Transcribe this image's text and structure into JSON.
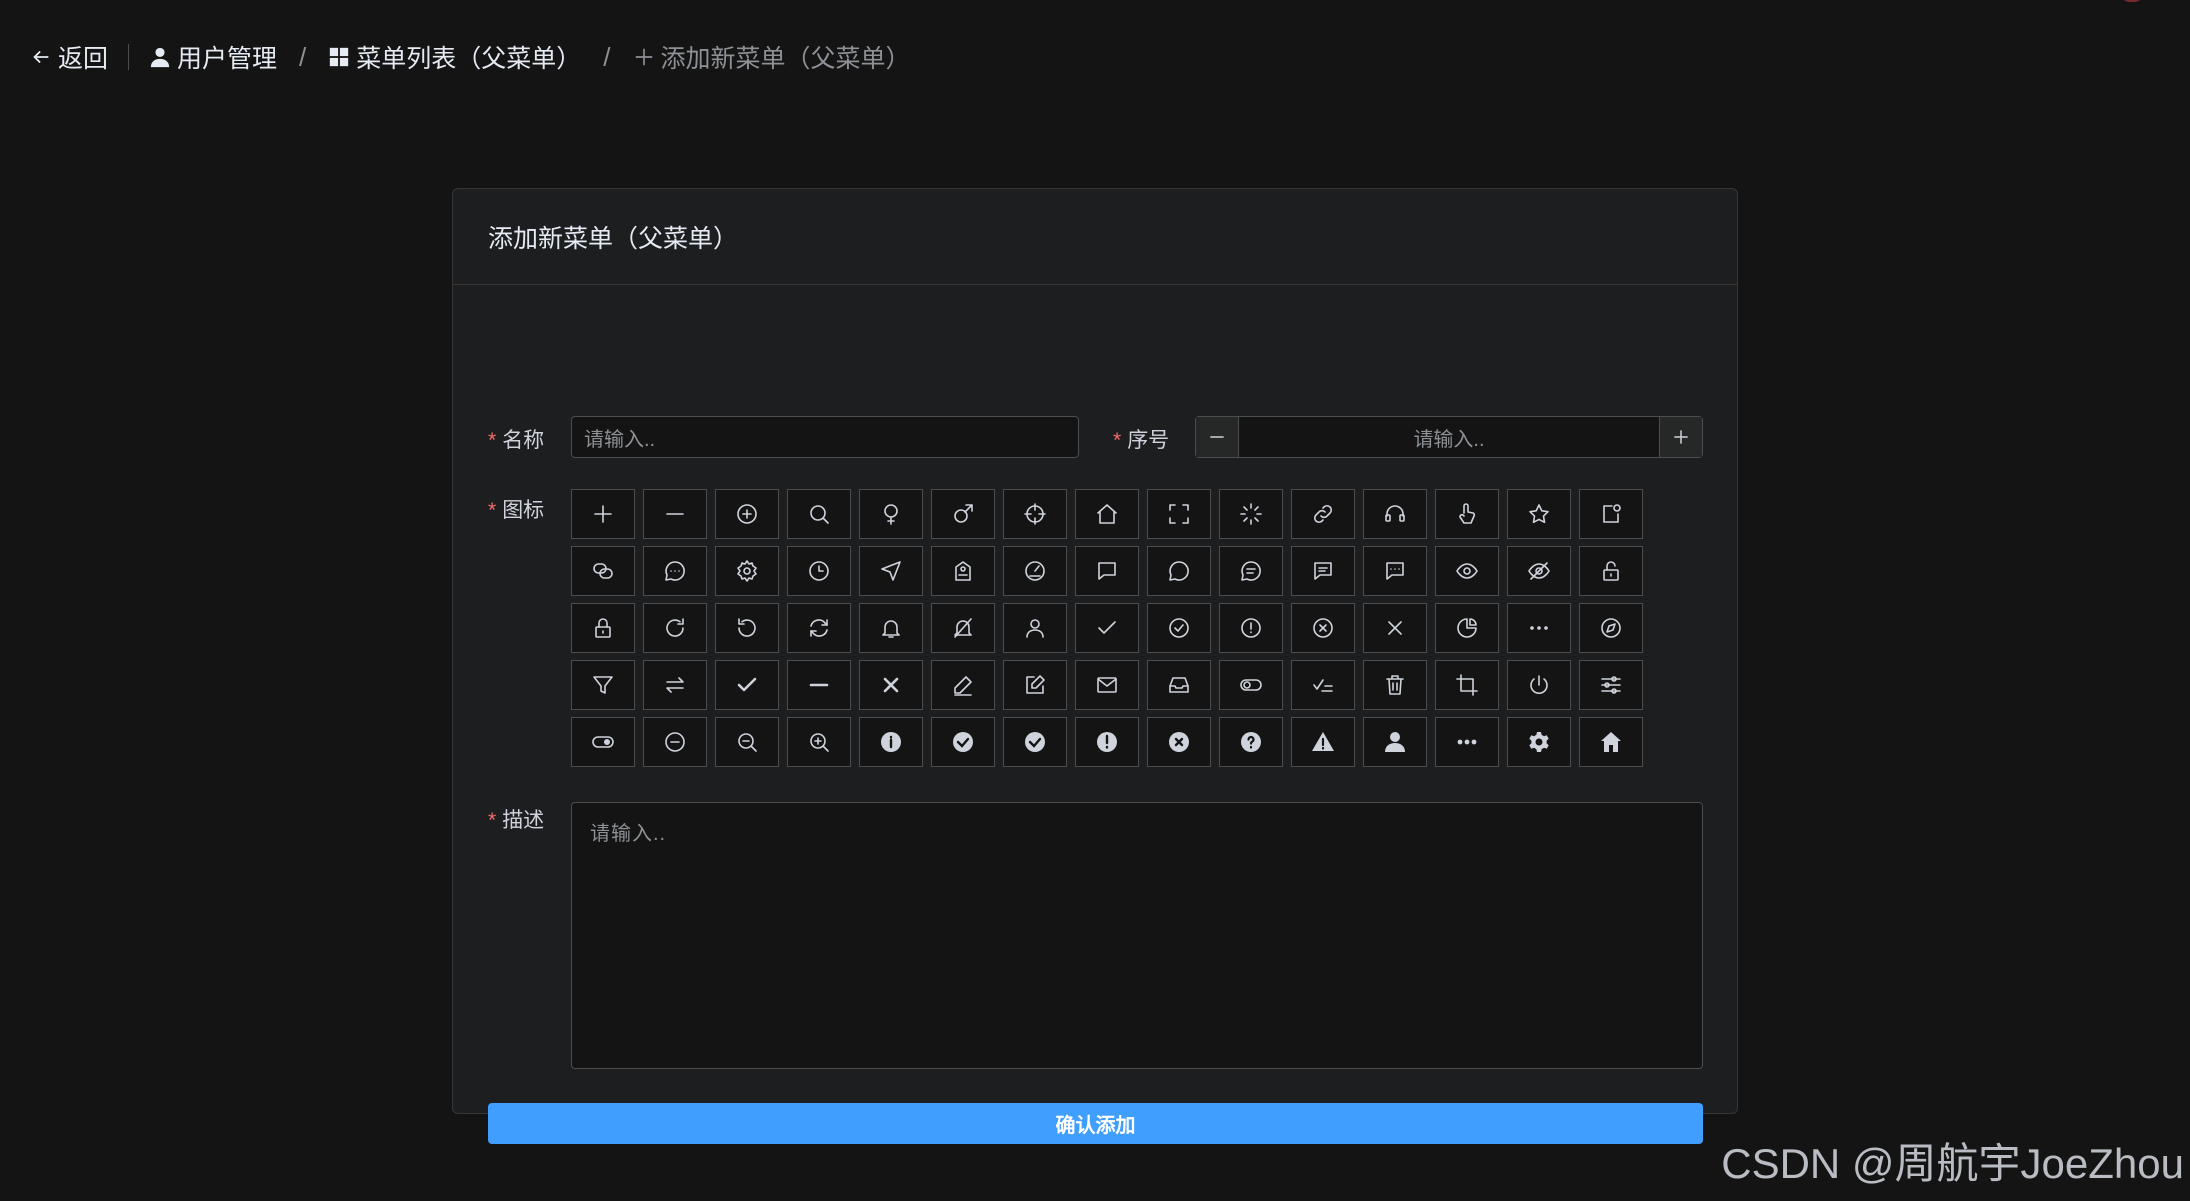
{
  "breadcrumb": {
    "back": "返回",
    "user_mgmt": "用户管理",
    "menu_list": "菜单列表（父菜单）",
    "current": "添加新菜单（父菜单）",
    "separator": "/"
  },
  "form": {
    "title": "添加新菜单（父菜单）",
    "required_mark": "*",
    "name_label": "名称",
    "name_placeholder": "请输入..",
    "order_label": "序号",
    "order_placeholder": "请输入..",
    "icon_label": "图标",
    "desc_label": "描述",
    "desc_placeholder": "请输入..",
    "submit_label": "确认添加"
  },
  "icons": [
    [
      "plus-icon",
      "minus-icon",
      "circle-plus-icon",
      "search-icon",
      "female-icon",
      "male-icon",
      "aim-icon",
      "house-icon",
      "full-screen-icon",
      "loading-icon",
      "link-icon",
      "service-icon",
      "pointer-icon",
      "star-icon",
      "notification-icon"
    ],
    [
      "connection-icon",
      "chat-dot-round-icon",
      "setting-icon",
      "clock-icon",
      "position-icon",
      "discount-icon",
      "odometer-icon",
      "chat-square-icon",
      "chat-round-icon",
      "chat-line-round-icon",
      "chat-line-square-icon",
      "chat-dot-square-icon",
      "view-icon",
      "hide-icon",
      "unlock-icon"
    ],
    [
      "lock-icon",
      "refresh-right-icon",
      "refresh-left-icon",
      "refresh-icon",
      "bell-icon",
      "mute-notification-icon",
      "user-icon",
      "check-icon",
      "circle-check-icon",
      "warning-icon",
      "circle-close-icon",
      "close-icon",
      "pie-chart-icon",
      "more-icon",
      "compass-icon"
    ],
    [
      "filter-icon",
      "switch-icon",
      "select-icon",
      "semi-select-icon",
      "close-bold-icon",
      "edit-pen-icon",
      "edit-icon",
      "message-icon",
      "message-box-icon",
      "turn-off-icon",
      "finished-icon",
      "delete-icon",
      "crop-icon",
      "switch-button-icon",
      "operation-icon"
    ],
    [
      "open-icon",
      "remove-icon",
      "zoom-out-icon",
      "zoom-in-icon",
      "info-filled-icon",
      "circle-check-filled-icon",
      "success-filled-icon",
      "warning-filled-icon",
      "circle-close-filled-icon",
      "question-filled-icon",
      "warn-triangle-filled-icon",
      "user-filled-icon",
      "more-filled-icon",
      "tools-icon",
      "home-filled-icon"
    ]
  ],
  "watermark": "CSDN @周航宇JoeZhou",
  "colors": {
    "primary": "#409eff",
    "required": "#f56c6c",
    "background": "#141414",
    "card": "#1d1e1f"
  }
}
